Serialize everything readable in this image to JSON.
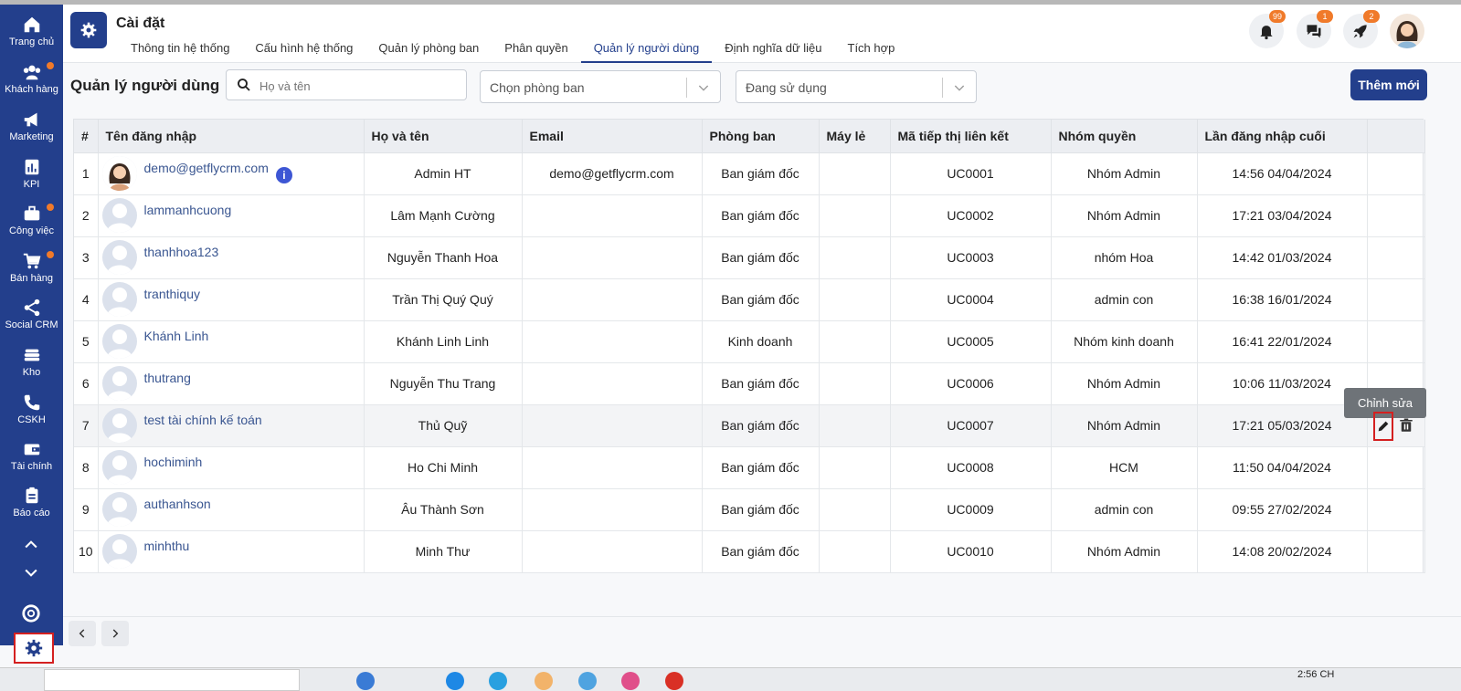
{
  "sidebar": {
    "items": [
      {
        "label": "Trang chủ",
        "icon": "home-icon"
      },
      {
        "label": "Khách hàng",
        "icon": "users-icon"
      },
      {
        "label": "Marketing",
        "icon": "megaphone-icon"
      },
      {
        "label": "KPI",
        "icon": "chart-bar-icon"
      },
      {
        "label": "Công việc",
        "icon": "briefcase-icon"
      },
      {
        "label": "Bán hàng",
        "icon": "cart-icon"
      },
      {
        "label": "Social CRM",
        "icon": "share-icon"
      },
      {
        "label": "Kho",
        "icon": "warehouse-icon"
      },
      {
        "label": "CSKH",
        "icon": "phone-icon"
      },
      {
        "label": "Tài chính",
        "icon": "wallet-icon"
      },
      {
        "label": "Báo cáo",
        "icon": "clipboard-icon"
      }
    ]
  },
  "header": {
    "title": "Cài đặt",
    "tabs": [
      {
        "label": "Thông tin hệ thống"
      },
      {
        "label": "Cấu hình hệ thống"
      },
      {
        "label": "Quản lý phòng ban"
      },
      {
        "label": "Phân quyền"
      },
      {
        "label": "Quản lý người dùng"
      },
      {
        "label": "Định nghĩa dữ liệu"
      },
      {
        "label": "Tích hợp"
      }
    ],
    "active_tab": "Quản lý người dùng",
    "notifications_badge": "99",
    "messages_badge": "1",
    "rocket_badge": "2"
  },
  "toolbar": {
    "section_title": "Quản lý người dùng",
    "search_placeholder": "Họ và tên",
    "department_select": "Chọn phòng ban",
    "status_select": "Đang sử dụng",
    "add_button": "Thêm mới"
  },
  "table": {
    "headers": [
      "#",
      "Tên đăng nhập",
      "Họ và tên",
      "Email",
      "Phòng ban",
      "Máy lẻ",
      "Mã tiếp thị liên kết",
      "Nhóm quyền",
      "Lần đăng nhập cuối"
    ],
    "rows": [
      {
        "n": "1",
        "username": "demo@getflycrm.com",
        "fullname": "Admin HT",
        "email": "demo@getflycrm.com",
        "dept": "Ban giám đốc",
        "ext": "",
        "code": "UC0001",
        "group": "Nhóm Admin",
        "last": "14:56 04/04/2024"
      },
      {
        "n": "2",
        "username": "lammanhcuong",
        "fullname": "Lâm Mạnh Cường",
        "email": "",
        "dept": "Ban giám đốc",
        "ext": "",
        "code": "UC0002",
        "group": "Nhóm Admin",
        "last": "17:21 03/04/2024"
      },
      {
        "n": "3",
        "username": "thanhhoa123",
        "fullname": "Nguyễn Thanh Hoa",
        "email": "",
        "dept": "Ban giám đốc",
        "ext": "",
        "code": "UC0003",
        "group": "nhóm Hoa",
        "last": "14:42 01/03/2024"
      },
      {
        "n": "4",
        "username": "tranthiquy",
        "fullname": "Trần Thị Quý Quý",
        "email": "",
        "dept": "Ban giám đốc",
        "ext": "",
        "code": "UC0004",
        "group": "admin con",
        "last": "16:38 16/01/2024"
      },
      {
        "n": "5",
        "username": "Khánh Linh",
        "fullname": "Khánh Linh Linh",
        "email": "",
        "dept": "Kinh doanh",
        "ext": "",
        "code": "UC0005",
        "group": "Nhóm kinh doanh",
        "last": "16:41 22/01/2024"
      },
      {
        "n": "6",
        "username": "thutrang",
        "fullname": "Nguyễn Thu Trang",
        "email": "",
        "dept": "Ban giám đốc",
        "ext": "",
        "code": "UC0006",
        "group": "Nhóm Admin",
        "last": "10:06 11/03/2024"
      },
      {
        "n": "7",
        "username": "test tài chính kế toán",
        "fullname": "Thủ Quỹ",
        "email": "",
        "dept": "Ban giám đốc",
        "ext": "",
        "code": "UC0007",
        "group": "Nhóm Admin",
        "last": "17:21 05/03/2024"
      },
      {
        "n": "8",
        "username": "hochiminh",
        "fullname": "Ho Chi Minh",
        "email": "",
        "dept": "Ban giám đốc",
        "ext": "",
        "code": "UC0008",
        "group": "HCM",
        "last": "11:50 04/04/2024"
      },
      {
        "n": "9",
        "username": "authanhson",
        "fullname": "Âu Thành Sơn",
        "email": "",
        "dept": "Ban giám đốc",
        "ext": "",
        "code": "UC0009",
        "group": "admin con",
        "last": "09:55 27/02/2024"
      },
      {
        "n": "10",
        "username": "minhthu",
        "fullname": "Minh Thư",
        "email": "",
        "dept": "Ban giám đốc",
        "ext": "",
        "code": "UC0010",
        "group": "Nhóm Admin",
        "last": "14:08 20/02/2024"
      }
    ],
    "tooltip": "Chỉnh sửa"
  },
  "taskbar": {
    "time": "2:56 CH"
  },
  "colors": {
    "brand": "#233f8c",
    "badge": "#f07a2a",
    "highlight": "#d42020"
  }
}
